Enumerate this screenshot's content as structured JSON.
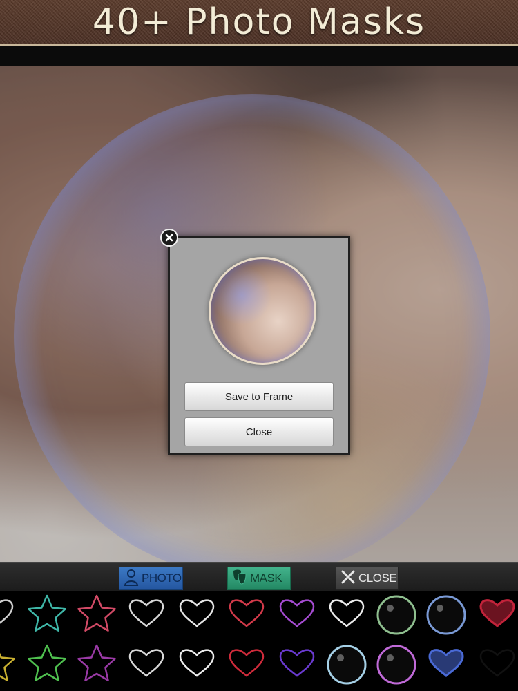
{
  "banner": {
    "title": "40+ Photo Masks"
  },
  "dialog": {
    "save_label": "Save to Frame",
    "close_label": "Close"
  },
  "toolbar": {
    "photo_label": "PHOTO",
    "mask_label": "MASK",
    "close_label": "CLOSE",
    "photo_color": "#2f68b4",
    "mask_color": "#2fa077",
    "close_color": "#4a4a4a"
  },
  "gallery": {
    "row1": [
      {
        "icon": "heart-outline-icon",
        "color": "#cfcfcf"
      },
      {
        "icon": "star-outline-icon",
        "color": "#3fb7a8"
      },
      {
        "icon": "star-outline-icon",
        "color": "#d24a66"
      },
      {
        "icon": "heart-outline-icon",
        "color": "#d8d8d8"
      },
      {
        "icon": "heart-outline-icon",
        "color": "#e6e6e6"
      },
      {
        "icon": "heart-outline-icon",
        "color": "#d33a4a"
      },
      {
        "icon": "heart-outline-icon",
        "color": "#a44bd0"
      },
      {
        "icon": "heart-outline-icon",
        "color": "#ededed"
      },
      {
        "icon": "bubble-icon",
        "color": "#8fbf8f"
      },
      {
        "icon": "bubble-icon",
        "color": "#7a9ad6"
      },
      {
        "icon": "heart-glow-icon",
        "color": "#c2233a"
      }
    ],
    "row2": [
      {
        "icon": "star-outline-icon",
        "color": "#c9b030"
      },
      {
        "icon": "star-outline-icon",
        "color": "#4fc04f"
      },
      {
        "icon": "star-outline-icon",
        "color": "#9a3aa6"
      },
      {
        "icon": "heart-outline-icon",
        "color": "#d8d8d8"
      },
      {
        "icon": "heart-outline-icon",
        "color": "#eeeeee"
      },
      {
        "icon": "heart-outline-icon",
        "color": "#cf2b3b"
      },
      {
        "icon": "heart-outline-icon",
        "color": "#6a3ad0"
      },
      {
        "icon": "bubble-icon",
        "color": "#a5d0e6"
      },
      {
        "icon": "bubble-icon",
        "color": "#c06ad8"
      },
      {
        "icon": "heart-glow-icon",
        "color": "#4a6ad6"
      },
      {
        "icon": "heart-outline-icon",
        "color": "#111111"
      }
    ]
  }
}
